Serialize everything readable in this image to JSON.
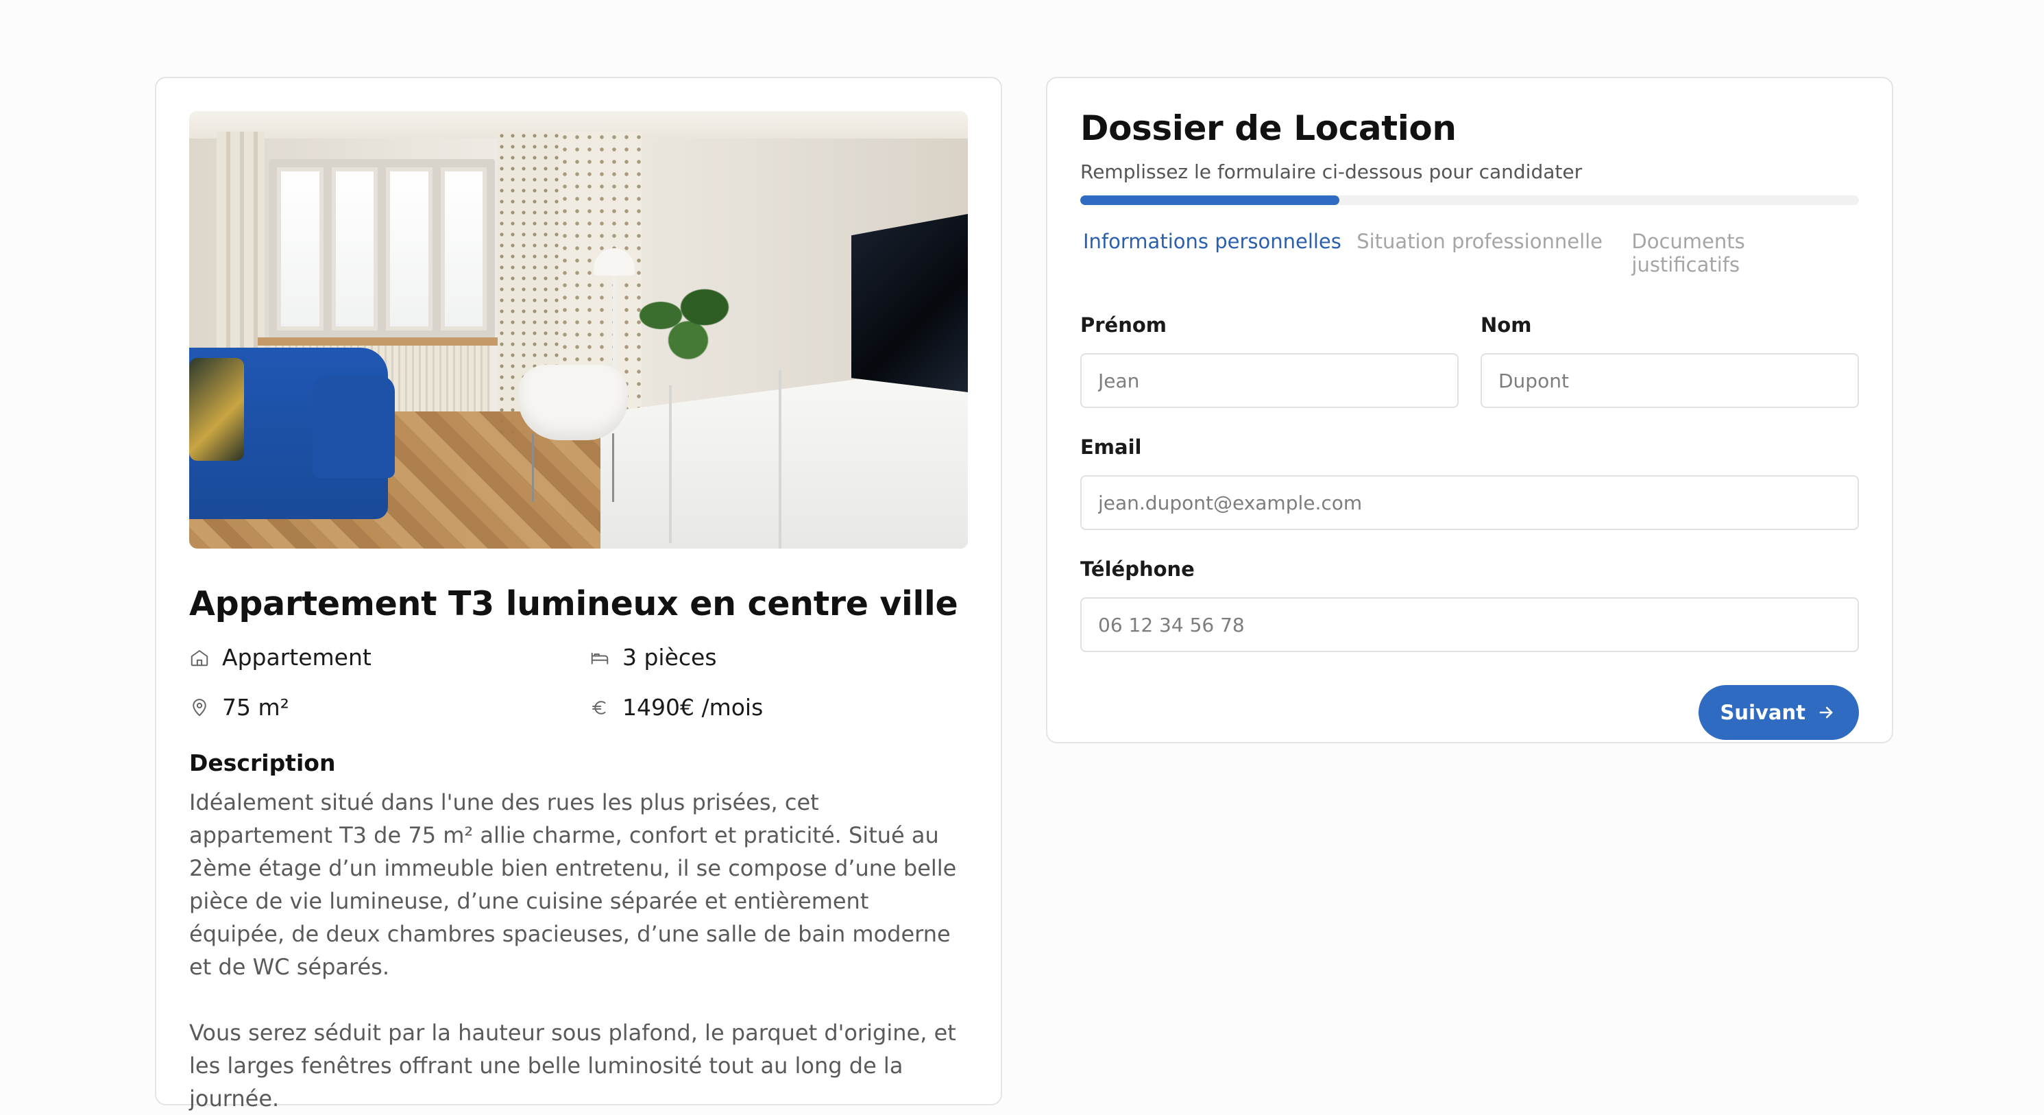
{
  "listing": {
    "title": "Appartement T3 lumineux en centre ville",
    "features": {
      "type": "Appartement",
      "rooms": "3 pièces",
      "surface": "75 m²",
      "price": "1490€ /mois"
    },
    "icons": {
      "type": "home-icon",
      "rooms": "bed-icon",
      "surface": "map-pin-icon",
      "price": "euro-icon"
    },
    "description_title": "Description",
    "description": [
      "Idéalement situé dans l'une des rues les plus prisées, cet appartement T3 de 75 m² allie charme, confort et praticité. Situé au 2ème étage d’un immeuble bien entretenu, il se compose d’une belle pièce de vie lumineuse, d’une cuisine séparée et entièrement équipée, de deux chambres spacieuses, d’une salle de bain moderne et de WC séparés.",
      "Vous serez séduit par la hauteur sous plafond, le parquet d'origine, et les larges fenêtres offrant une belle luminosité tout au long de la journée."
    ]
  },
  "form": {
    "title": "Dossier de Location",
    "subtitle": "Remplissez le formulaire ci-dessous pour candidater",
    "progress": 0.333,
    "steps": [
      {
        "label": "Informations personnelles",
        "active": true
      },
      {
        "label": "Situation professionnelle",
        "active": false
      },
      {
        "label": "Documents justificatifs",
        "active": false
      }
    ],
    "fields": {
      "first_name": {
        "label": "Prénom",
        "placeholder": "Jean"
      },
      "last_name": {
        "label": "Nom",
        "placeholder": "Dupont"
      },
      "email": {
        "label": "Email",
        "placeholder": "jean.dupont@example.com"
      },
      "phone": {
        "label": "Téléphone",
        "placeholder": "06 12 34 56 78"
      }
    },
    "next_label": "Suivant"
  },
  "colors": {
    "accent": "#2f6bc1",
    "active_step": "#2a5fae",
    "inactive_step": "#a5a5a5"
  }
}
